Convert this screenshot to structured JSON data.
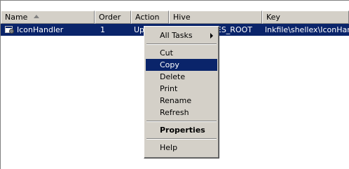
{
  "columns": [
    {
      "id": "name",
      "label": "Name"
    },
    {
      "id": "order",
      "label": "Order"
    },
    {
      "id": "action",
      "label": "Action"
    },
    {
      "id": "hive",
      "label": "Hive"
    },
    {
      "id": "key",
      "label": "Key"
    }
  ],
  "rows": [
    {
      "name": "IconHandler",
      "order": "1",
      "action": "Up",
      "hive": "ES_ROOT",
      "key": "lnkfile\\shellex\\IconHandler"
    }
  ],
  "context_menu": {
    "all_tasks": "All Tasks",
    "cut": "Cut",
    "copy": "Copy",
    "delete": "Delete",
    "print": "Print",
    "rename": "Rename",
    "refresh": "Refresh",
    "properties": "Properties",
    "help": "Help",
    "selected_item": "Copy"
  },
  "colors": {
    "selection": "#0a246a",
    "menu_background": "#d4d0c8",
    "window_background": "#ffffff"
  }
}
